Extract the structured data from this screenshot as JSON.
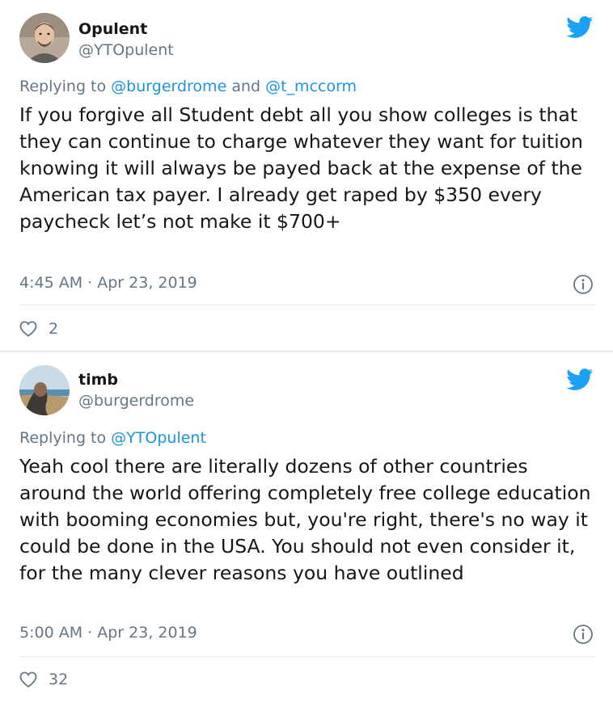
{
  "tweets": [
    {
      "name": "Opulent",
      "handle": "@YTOpulent",
      "reply_prefix": "Replying to",
      "reply_mentions": [
        "@burgerdrome",
        "@t_mccorm"
      ],
      "reply_joiner": "and",
      "text": "If you forgive all Student debt all you show colleges is that they can continue to charge whatever they want for tuition knowing it will always be payed back at the expense of the American tax payer. I already get raped by $350 every paycheck let’s not make it $700+",
      "time": "4:45 AM",
      "date": "Apr 23, 2019",
      "likes": "2"
    },
    {
      "name": "timb",
      "handle": "@burgerdrome",
      "reply_prefix": "Replying to",
      "reply_mentions": [
        "@YTOpulent"
      ],
      "text": "Yeah cool there are literally dozens of other countries around the world offering completely free college education with booming economies but, you're right, there's no way it could be done in the USA. You should not even consider it, for the many clever reasons you have outlined",
      "time": "5:00 AM",
      "date": "Apr 23, 2019",
      "likes": "32"
    }
  ],
  "meta_separator": "·",
  "colors": {
    "twitter_blue": "#1da1f2",
    "mention_blue": "#1b95e0",
    "secondary_text": "#657786",
    "primary_text": "#14171a"
  },
  "icons": {
    "brand": "twitter-bird-icon",
    "info": "info-icon",
    "like": "heart-icon"
  }
}
